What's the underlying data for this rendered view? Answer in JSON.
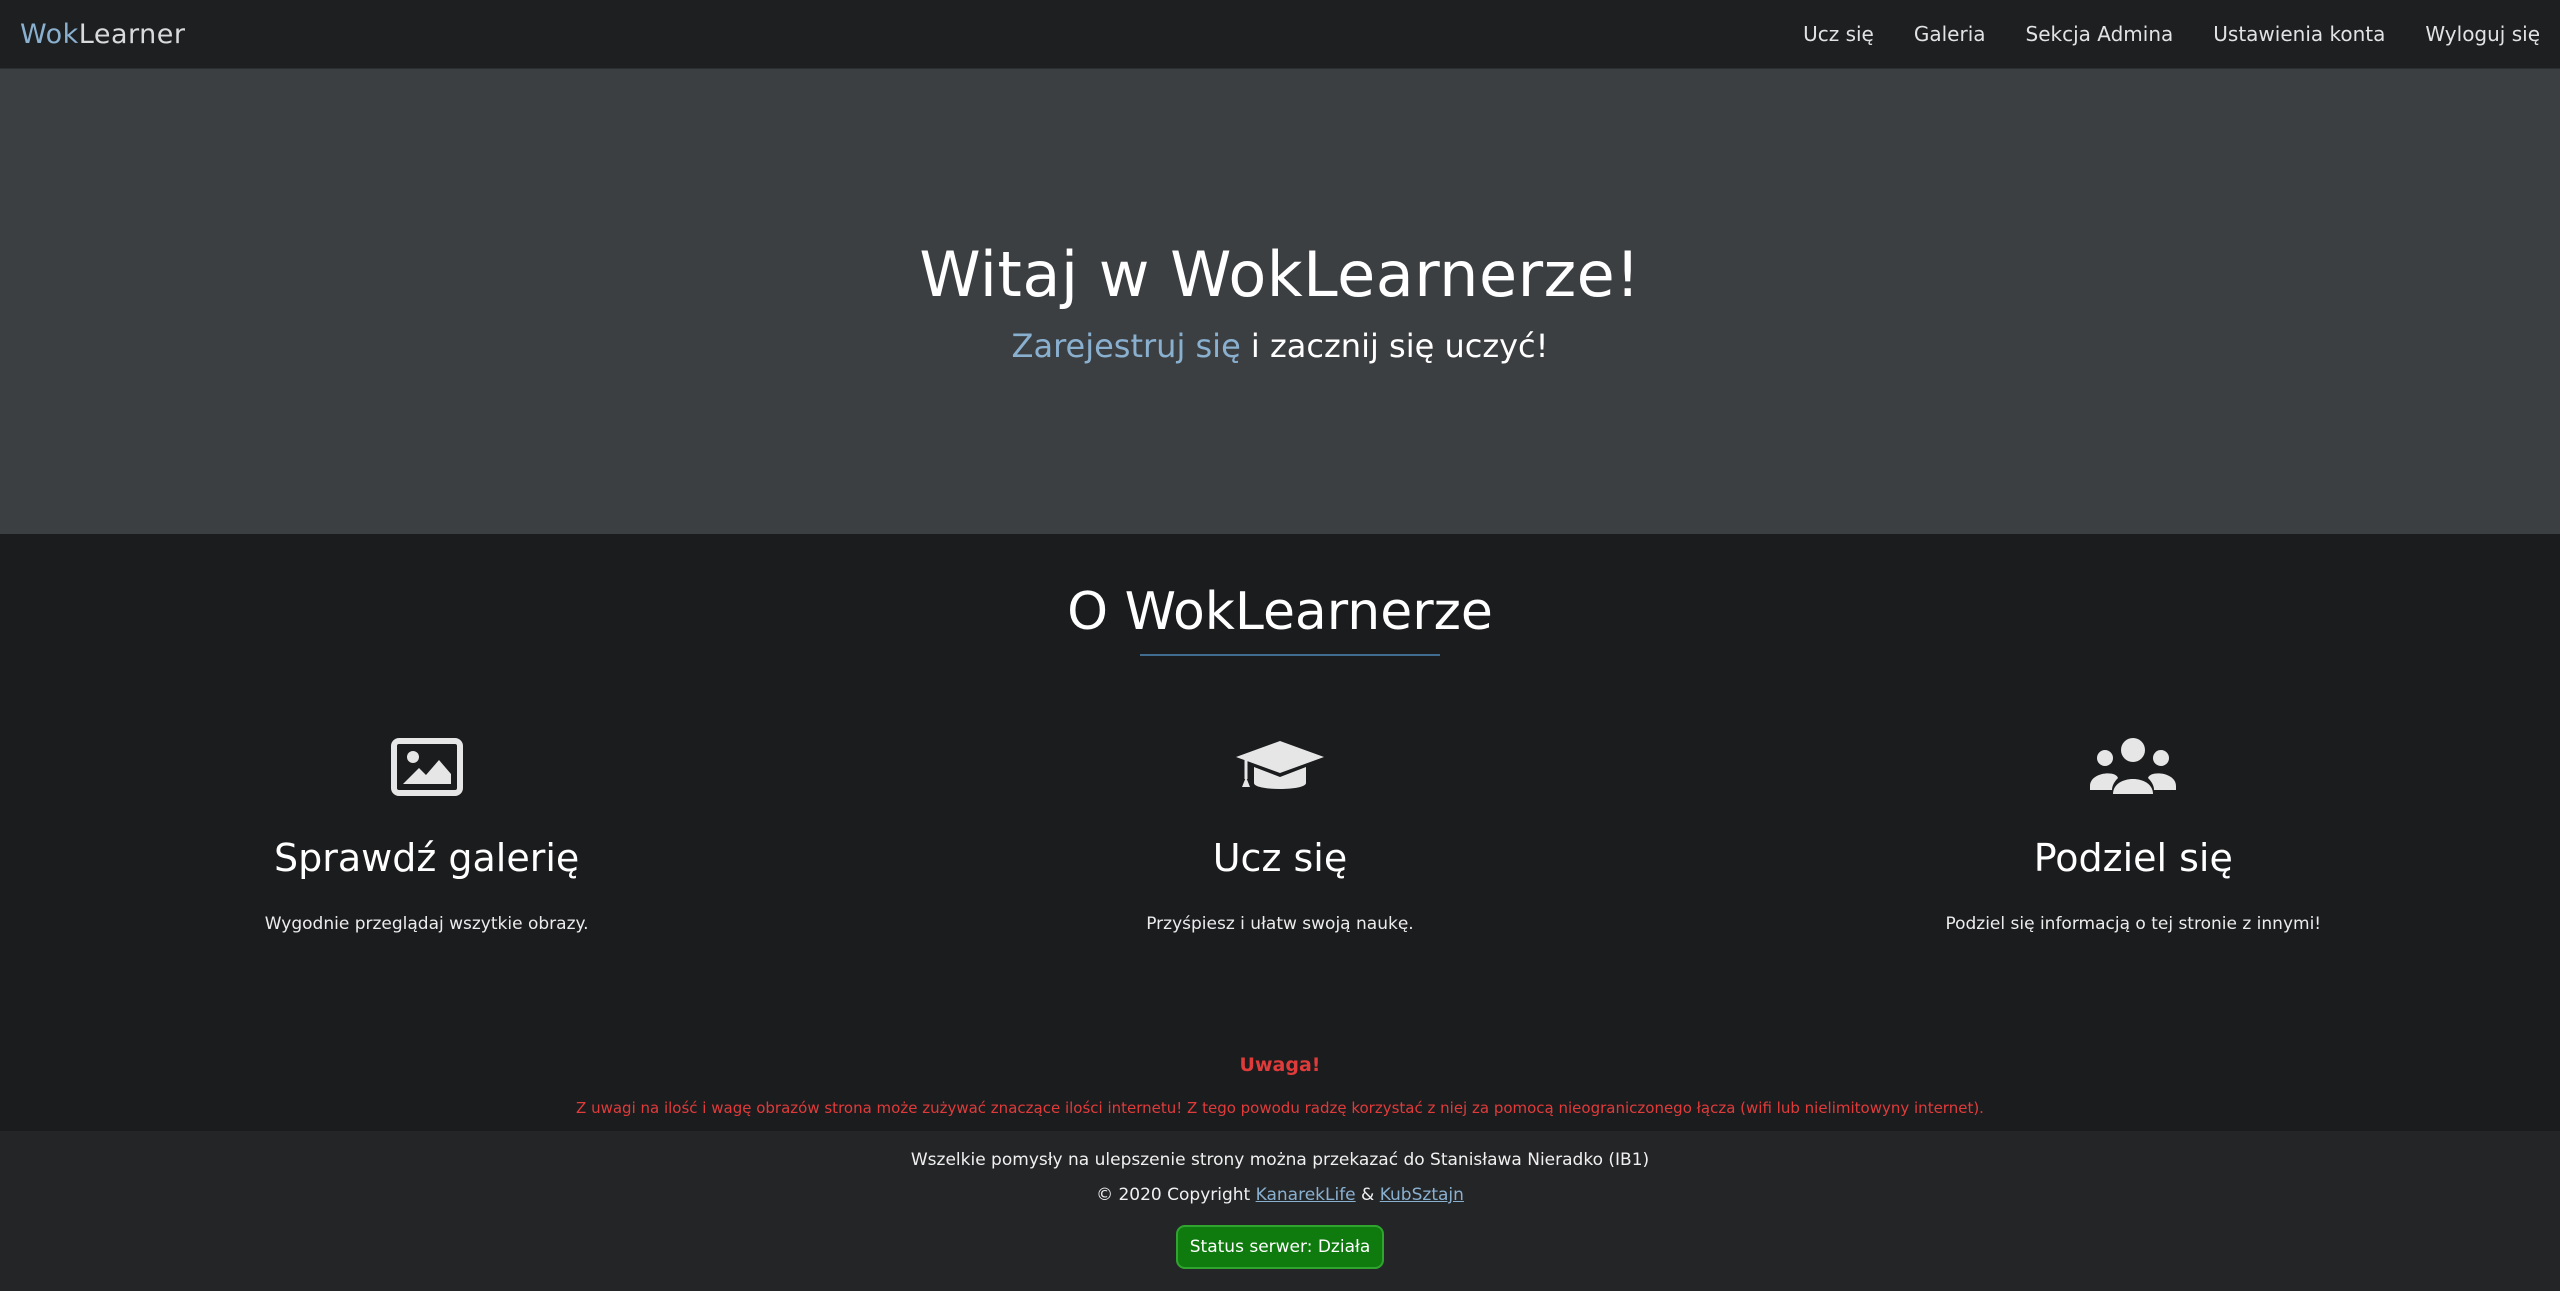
{
  "navbar": {
    "brand_part1": "Wok",
    "brand_part2": "Learner",
    "links": [
      "Ucz się",
      "Galeria",
      "Sekcja Admina",
      "Ustawienia konta",
      "Wyloguj się"
    ]
  },
  "hero": {
    "title": "Witaj w WokLearnerze!",
    "register_link": "Zarejestruj się",
    "subtitle_rest": " i zacznij się uczyć!"
  },
  "about": {
    "title": "O WokLearnerze",
    "features": [
      {
        "icon": "image-icon",
        "title": "Sprawdź galerię",
        "text": "Wygodnie przeglądaj wszytkie obrazy."
      },
      {
        "icon": "graduation-cap-icon",
        "title": "Ucz się",
        "text": "Przyśpiesz i ułatw swoją naukę."
      },
      {
        "icon": "users-icon",
        "title": "Podziel się",
        "text": "Podziel się informacją o tej stronie z innymi!"
      }
    ]
  },
  "warning": {
    "title": "Uwaga!",
    "text": "Z uwagi na ilość i wagę obrazów strona może zużywać znaczące ilości internetu! Z tego powodu radzę korzystać z niej za pomocą nieograniczonego łącza (wifi lub nielimitowyny internet)."
  },
  "footer": {
    "ideas_text": "Wszelkie pomysły na ulepszenie strony można przekazać do Stanisława Nieradko (IB1)",
    "copyright_prefix": "© 2020 Copyright ",
    "author1": "KanarekLife",
    "and": " & ",
    "author2": "KubSztajn",
    "status": "Status serwer: Działa"
  },
  "colors": {
    "accent": "#8ab0d0",
    "warning": "#e03b3b",
    "status_ok": "#0f7b0f"
  }
}
